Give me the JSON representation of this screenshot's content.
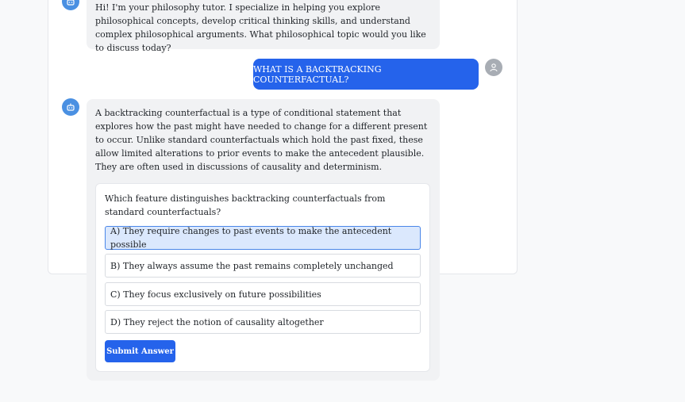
{
  "messages": {
    "bot_intro": "Hi! I'm your philosophy tutor. I specialize in helping you explore philosophical concepts, develop critical thinking skills, and understand complex philosophical arguments. What philosophical topic would you like to discuss today?",
    "user_question": "WHAT IS A BACKTRACKING COUNTERFACTUAL?",
    "bot_answer": "A backtracking counterfactual is a type of conditional statement that explores how the past might have needed to change for a different present to occur. Unlike standard counterfactuals which hold the past fixed, these allow limited alterations to prior events to make the antecedent plausible. They are often used in discussions of causality and determinism."
  },
  "quiz": {
    "question": "Which feature distinguishes backtracking counterfactuals from standard counterfactuals?",
    "options": [
      "A) They require changes to past events to make the antecedent possible",
      "B) They always assume the past remains completely unchanged",
      "C) They focus exclusively on future possibilities",
      "D) They reject the notion of causality altogether"
    ],
    "selected_option": "A",
    "submit_label": "Submit Answer"
  },
  "icons": {
    "bot": "robot-icon",
    "user": "user-icon"
  },
  "colors": {
    "accent": "#2563eb",
    "bot_avatar": "#4a90e2",
    "user_avatar": "#a8adb4",
    "bot_bubble": "#f1f2f4",
    "selected_option_bg": "#dbe8fd"
  }
}
